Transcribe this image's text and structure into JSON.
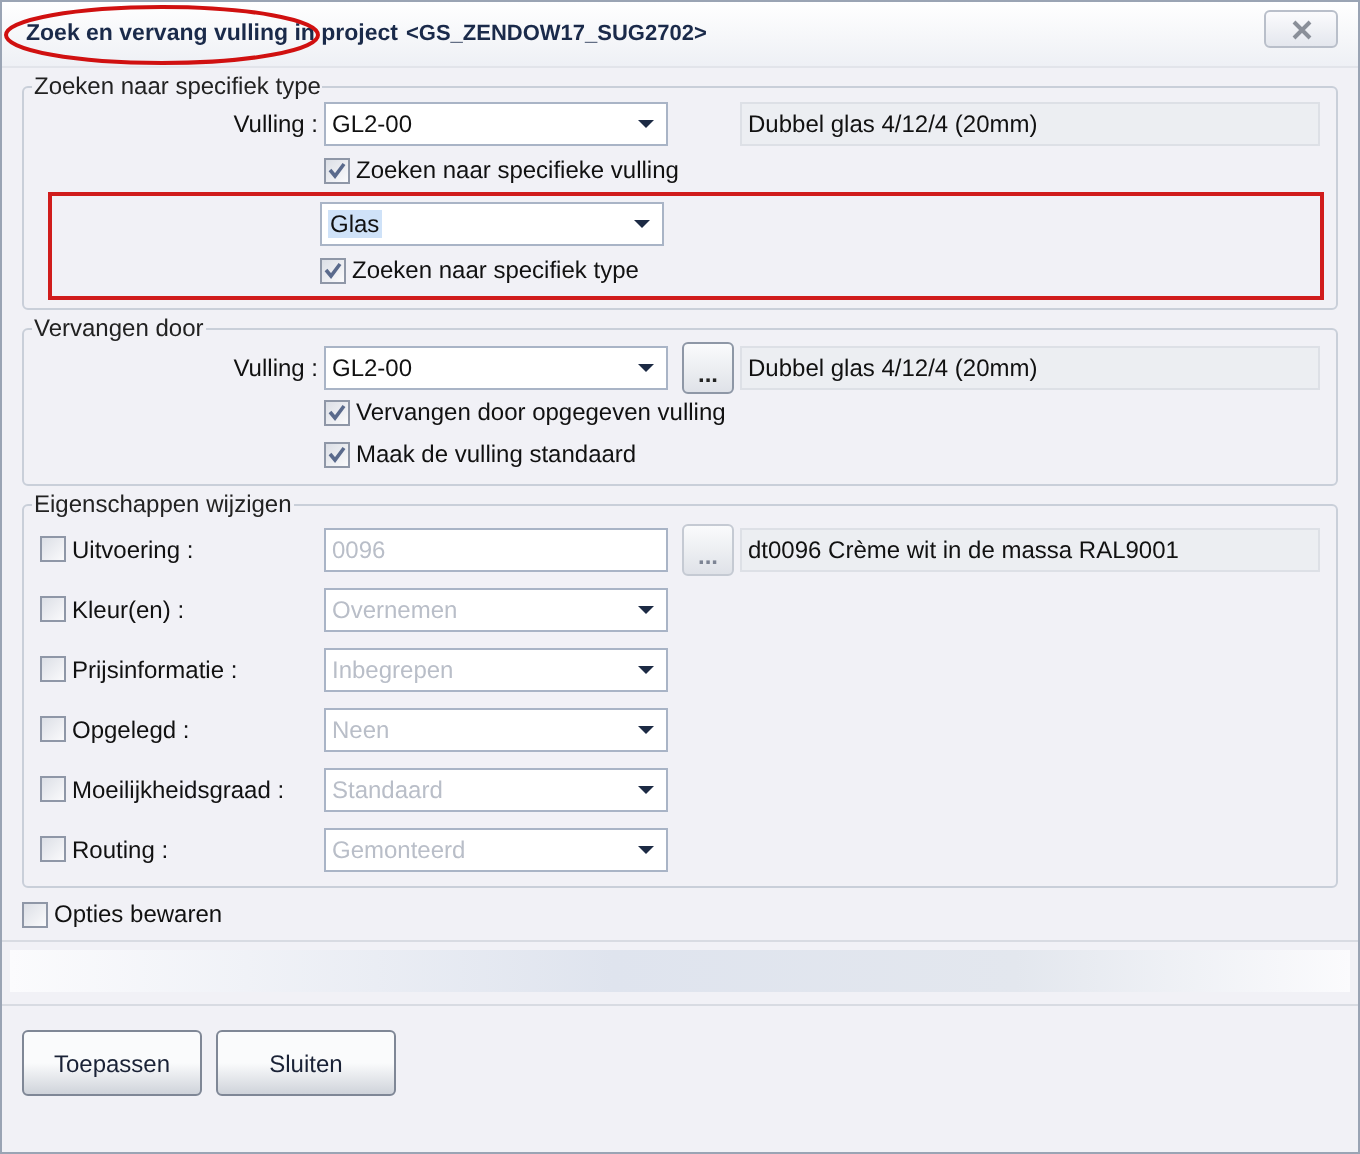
{
  "window": {
    "title": "Zoek en vervang vulling in project",
    "project": "<GS_ZENDOW17_SUG2702>"
  },
  "search_group": {
    "legend": "Zoeken naar specifiek type",
    "filling": {
      "label": "Vulling :",
      "value": "GL2-00",
      "description": "Dubbel glas 4/12/4 (20mm)"
    },
    "filling_check": {
      "label": "Zoeken naar specifieke vulling",
      "checked": true
    },
    "type_field": {
      "value": "Glas",
      "text_selected": true
    },
    "type_check": {
      "label": "Zoeken naar specifiek type",
      "checked": true
    }
  },
  "replace_group": {
    "legend": "Vervangen door",
    "filling": {
      "label": "Vulling :",
      "value": "GL2-00",
      "browse": "...",
      "description": "Dubbel glas 4/12/4 (20mm)"
    },
    "checks": [
      {
        "label": "Vervangen door opgegeven vulling",
        "checked": true
      },
      {
        "label": "Maak de vulling standaard",
        "checked": true
      }
    ]
  },
  "properties_group": {
    "legend": "Eigenschappen wijzigen",
    "rows": [
      {
        "kind": "text",
        "label": "Uitvoering :",
        "checked": false,
        "value": "0096",
        "disabled": true,
        "browse": "...",
        "description": "dt0096 Crème wit in de massa RAL9001"
      },
      {
        "kind": "dropdown",
        "label": "Kleur(en) :",
        "checked": false,
        "value": "Overnemen",
        "disabled": true
      },
      {
        "kind": "dropdown",
        "label": "Prijsinformatie :",
        "checked": false,
        "value": "Inbegrepen",
        "disabled": true
      },
      {
        "kind": "dropdown",
        "label": "Opgelegd :",
        "checked": false,
        "value": "Neen",
        "disabled": true
      },
      {
        "kind": "dropdown",
        "label": "Moeilijkheidsgraad :",
        "checked": false,
        "value": "Standaard",
        "disabled": true
      },
      {
        "kind": "dropdown",
        "label": "Routing :",
        "checked": false,
        "value": "Gemonteerd",
        "disabled": true
      }
    ]
  },
  "save_options": {
    "label": "Opties bewaren",
    "checked": false
  },
  "buttons": [
    "Toepassen",
    "Sluiten"
  ]
}
